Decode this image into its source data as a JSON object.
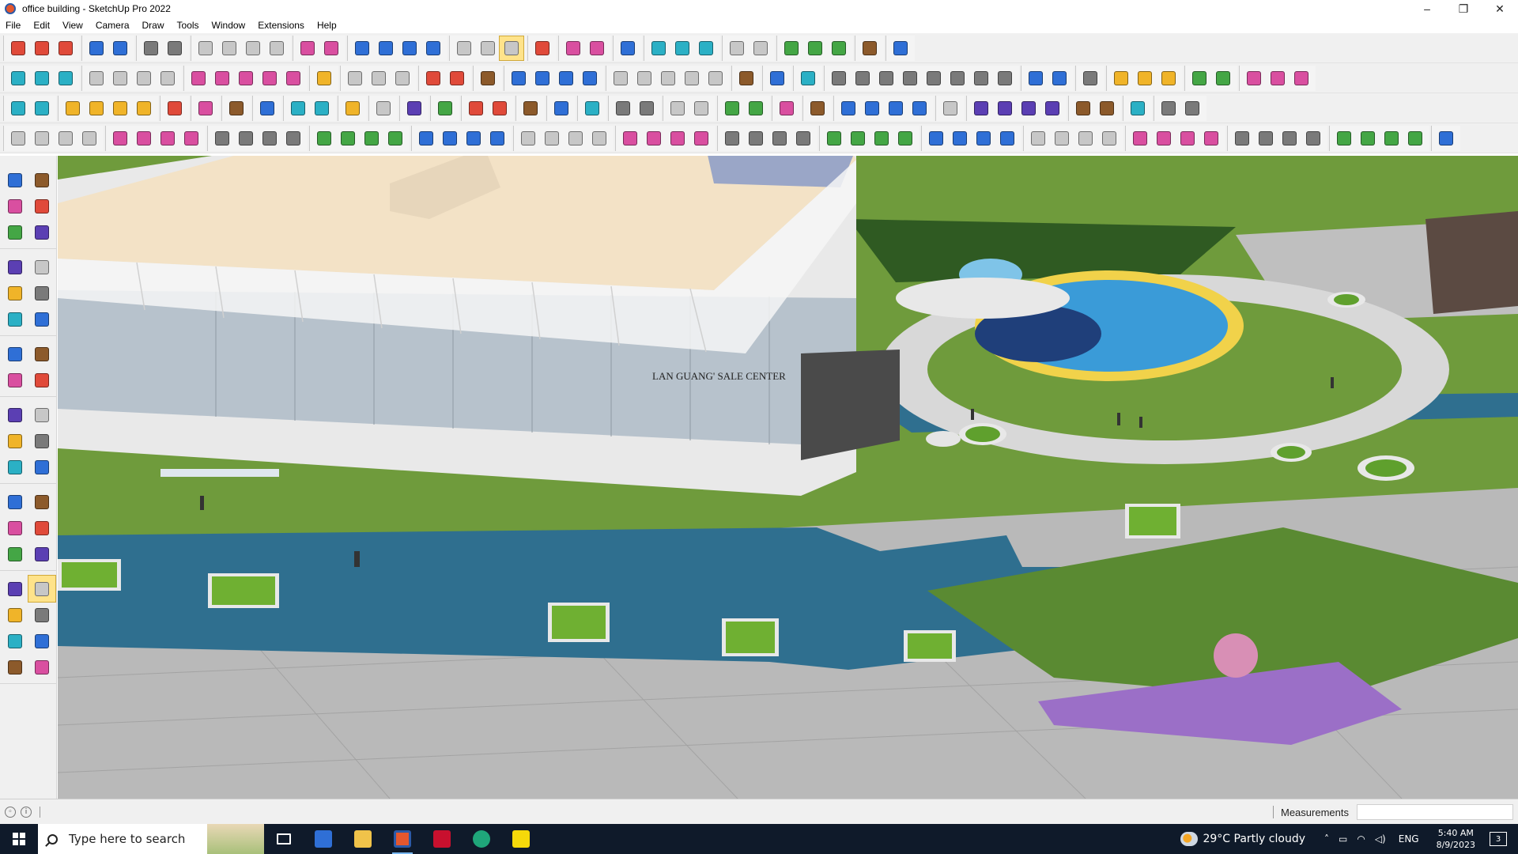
{
  "window": {
    "title": "office building - SketchUp Pro 2022",
    "controls": {
      "minimize": "–",
      "maximize": "❐",
      "close": "✕"
    }
  },
  "menu": [
    "File",
    "Edit",
    "View",
    "Camera",
    "Draw",
    "Tools",
    "Window",
    "Extensions",
    "Help"
  ],
  "toolbar_colors": [
    "#e04a3a",
    "#2f6fd6",
    "#f0b429",
    "#44a645",
    "#8c5a2b",
    "#7a7a7a",
    "#5b3fb3",
    "#d94fa0",
    "#2bb0c5",
    "#c7c7c7"
  ],
  "viewport": {
    "sign_text": "LAN GUANG' SALE CENTER",
    "colors": {
      "grass": "#6f9b3c",
      "water": "#2f6f8f",
      "paving": "#b9b9b9",
      "roof": "#f3e2c6",
      "glass": "#b7c2cc",
      "hedge": "#2f5a22",
      "flowers": "#9b6fc7",
      "pool": "#3a9bd8"
    }
  },
  "status": {
    "left_icons": [
      "geo-location",
      "credits-info"
    ],
    "measurements_label": "Measurements",
    "measurements_value": ""
  },
  "taskbar": {
    "search_placeholder": "Type here to search",
    "apps": [
      "task-view",
      "calculator",
      "file-explorer",
      "sketchup",
      "acrobat",
      "edge",
      "sticky-notes"
    ],
    "active_app": "sketchup",
    "weather": "29°C  Partly cloudy",
    "language": "ENG",
    "time": "5:40 AM",
    "date": "8/9/2023",
    "notifications": "3"
  }
}
